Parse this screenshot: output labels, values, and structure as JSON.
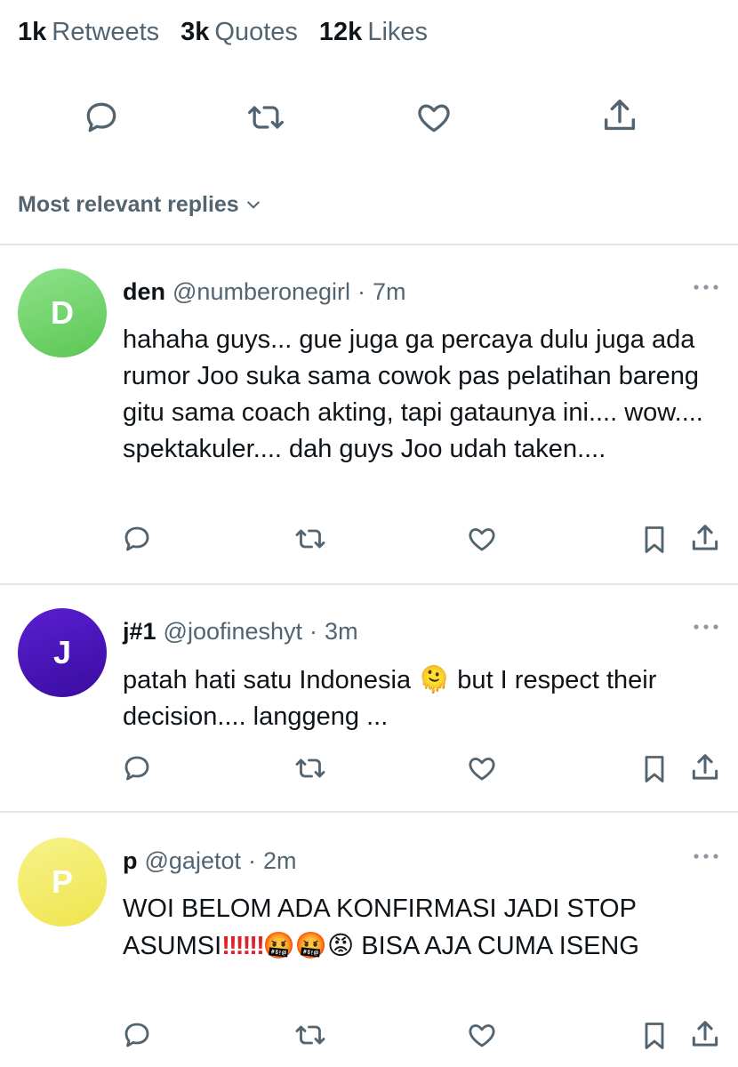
{
  "stats": {
    "retweets": {
      "count": "1k",
      "label": "Retweets"
    },
    "quotes": {
      "count": "3k",
      "label": "Quotes"
    },
    "likes": {
      "count": "12k",
      "label": "Likes"
    }
  },
  "tweet_actions": [
    "reply-icon",
    "retweet-icon",
    "like-icon",
    "share-icon"
  ],
  "sort": {
    "label": "Most relevant replies"
  },
  "colors": {
    "text": "#0f1419",
    "secondary": "#536471",
    "divider": "#e2e6e9",
    "avatar_d": "#6fd468",
    "avatar_j": "#4a13b8",
    "avatar_p": "#f4ec6a",
    "exclamation": "#e0202a"
  },
  "replies": [
    {
      "name": "den",
      "handle": "@numberonegirl",
      "dot": "·",
      "time": "7m",
      "avatar_letter": "D",
      "text": "hahaha guys... gue juga ga percaya dulu juga ada rumor Joo suka sama cowok pas pelatihan bareng gitu sama coach akting, tapi gataunya ini.... wow.... spektakuler.... dah guys Joo udah taken...."
    },
    {
      "name": "j#1",
      "handle": "@joofineshyt",
      "dot": "·",
      "time": "3m",
      "avatar_letter": "J",
      "text_before": "patah hati satu Indonesia ",
      "emoji": "🫠",
      "text_after": " but I respect their decision.... langgeng ..."
    },
    {
      "name": "p",
      "handle": "@gajetot",
      "dot": "·",
      "time": "2m",
      "avatar_letter": "P",
      "text_line1": "WOI BELOM ADA KONFIRMASI JADI STOP",
      "text_asumsi": "ASUMSI",
      "exclamations": "‼‼‼",
      "emojis": "🤬🤬😡",
      "text_after": " BISA AJA CUMA ISENG"
    }
  ]
}
